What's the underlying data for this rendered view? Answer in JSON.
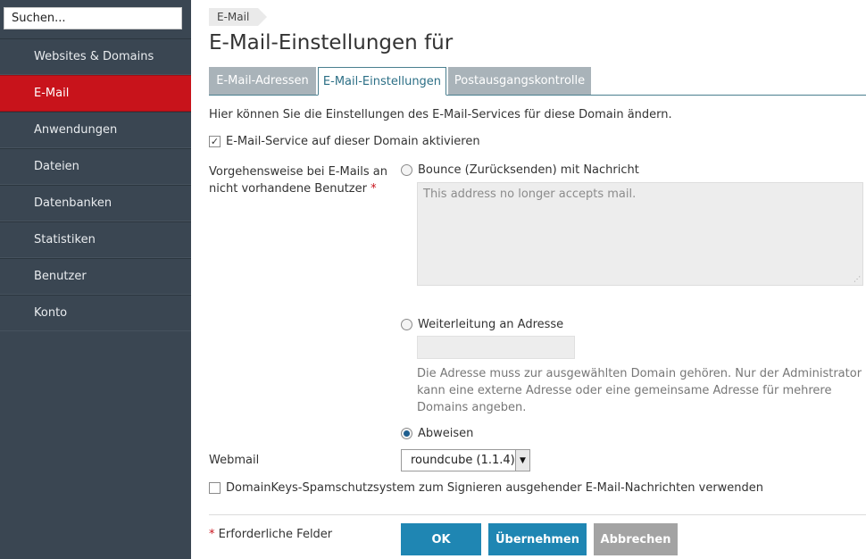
{
  "sidebar": {
    "search_value": "Suchen...",
    "items": [
      {
        "label": "Websites & Domains",
        "active": false
      },
      {
        "label": "E-Mail",
        "active": true
      },
      {
        "label": "Anwendungen",
        "active": false
      },
      {
        "label": "Dateien",
        "active": false
      },
      {
        "label": "Datenbanken",
        "active": false
      },
      {
        "label": "Statistiken",
        "active": false
      },
      {
        "label": "Benutzer",
        "active": false
      },
      {
        "label": "Konto",
        "active": false
      }
    ]
  },
  "breadcrumb": "E-Mail",
  "page_title": "E-Mail-Einstellungen für",
  "tabs": [
    {
      "label": "E-Mail-Adressen",
      "active": false
    },
    {
      "label": "E-Mail-Einstellungen",
      "active": true
    },
    {
      "label": "Postausgangskontrolle",
      "active": false
    }
  ],
  "form": {
    "intro": "Hier können Sie die Einstellungen des E-Mail-Services für diese Domain ändern.",
    "enable_mail": {
      "label": "E-Mail-Service auf dieser Domain aktivieren",
      "checked": true
    },
    "nonexistent_label": "Vorgehensweise bei E-Mails an nicht vorhandene Benutzer",
    "required_mark": "*",
    "options": {
      "bounce": {
        "label": "Bounce (Zurücksenden) mit Nachricht",
        "selected": false,
        "message_placeholder": "This address no longer accepts mail."
      },
      "forward": {
        "label": "Weiterleitung an Adresse",
        "selected": false,
        "address_value": "",
        "hint": "Die Adresse muss zur ausgewählten Domain gehören. Nur der Administrator kann eine externe Adresse oder eine gemeinsame Adresse für mehrere Domains angeben."
      },
      "reject": {
        "label": "Abweisen",
        "selected": true
      }
    },
    "webmail": {
      "label": "Webmail",
      "selected": "roundcube (1.1.4)"
    },
    "domainkeys": {
      "label": "DomainKeys-Spamschutzsystem zum Signieren ausgehender E-Mail-Nachrichten verwenden",
      "checked": false
    },
    "required_note": "Erforderliche Felder"
  },
  "buttons": {
    "ok": "OK",
    "apply": "Übernehmen",
    "cancel": "Abbrechen"
  },
  "colors": {
    "sidebar_bg": "#3a4652",
    "active_nav": "#c8131b",
    "primary_button": "#1f86b3",
    "secondary_button": "#a3a3a3"
  }
}
